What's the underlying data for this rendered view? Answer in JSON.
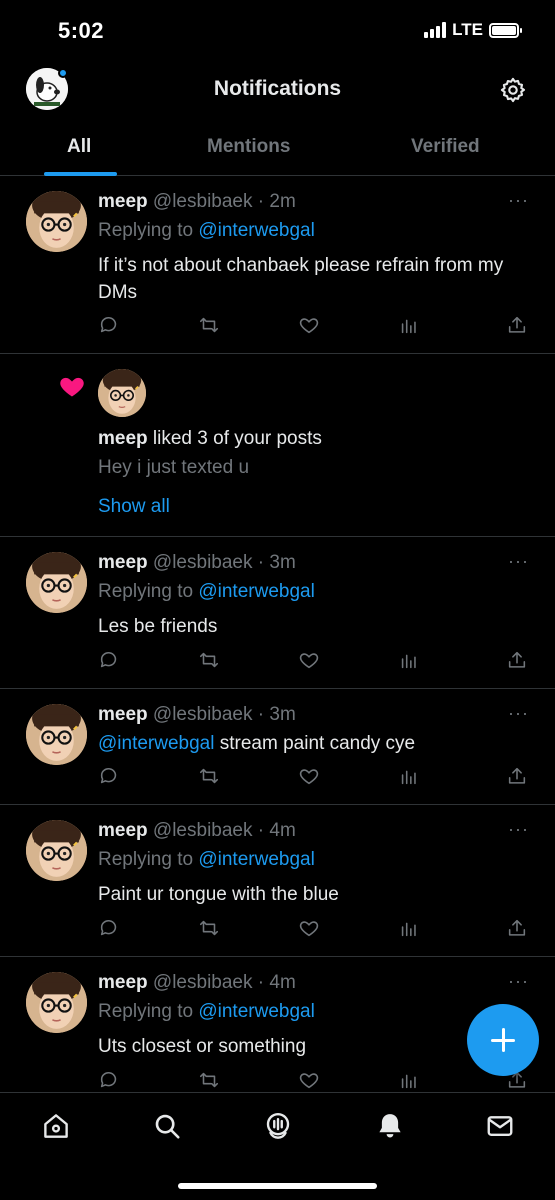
{
  "status_bar": {
    "time": "5:02",
    "network": "LTE"
  },
  "header": {
    "title": "Notifications",
    "profile_icon": "avatar-snoopy",
    "settings_icon": "gear-icon"
  },
  "tabs": [
    {
      "label": "All",
      "active": true
    },
    {
      "label": "Mentions",
      "active": false
    },
    {
      "label": "Verified",
      "active": false
    }
  ],
  "notifications": [
    {
      "type": "reply",
      "name": "meep",
      "handle": "@lesbibaek",
      "time": "· 2m",
      "replying_prefix": "Replying to",
      "replying_to": "@interwebgal",
      "text": "If it’s not about chanbaek please refrain from my DMs"
    },
    {
      "type": "like",
      "name": "meep",
      "action": "liked 3 of your posts",
      "preview": "Hey i just texted u",
      "show_all": "Show all"
    },
    {
      "type": "reply",
      "name": "meep",
      "handle": "@lesbibaek",
      "time": "· 3m",
      "replying_prefix": "Replying to",
      "replying_to": "@interwebgal",
      "text": "Les be friends"
    },
    {
      "type": "mention",
      "name": "meep",
      "handle": "@lesbibaek",
      "time": "· 3m",
      "mention": "@interwebgal",
      "text": "stream paint candy cye"
    },
    {
      "type": "reply",
      "name": "meep",
      "handle": "@lesbibaek",
      "time": "· 4m",
      "replying_prefix": "Replying to",
      "replying_to": "@interwebgal",
      "text": "Paint ur tongue with the blue"
    },
    {
      "type": "reply",
      "name": "meep",
      "handle": "@lesbibaek",
      "time": "· 4m",
      "replying_prefix": "Replying to",
      "replying_to": "@interwebgal",
      "text": "Uts  closest or something"
    }
  ],
  "more_label": "···",
  "bottom_nav": [
    "home-icon",
    "search-icon",
    "spaces-icon",
    "notifications-icon",
    "messages-icon"
  ],
  "colors": {
    "accent": "#1d9bf0",
    "like": "#f91880",
    "background": "#000000",
    "muted": "#71767b"
  }
}
